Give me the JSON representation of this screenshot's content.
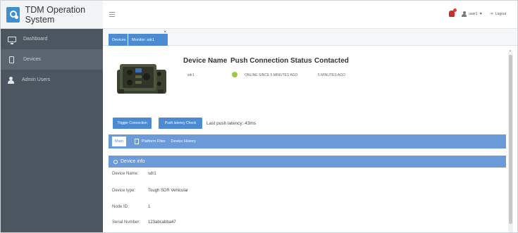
{
  "app": {
    "title": "TDM Operation System"
  },
  "sidebar": {
    "items": [
      {
        "label": "Dashboard",
        "icon": "monitor-icon"
      },
      {
        "label": "Devices",
        "icon": "device-icon"
      },
      {
        "label": "Admin Users",
        "icon": "user-icon"
      }
    ]
  },
  "topbar": {
    "user": "user1",
    "logout": "Logout"
  },
  "tabs": [
    {
      "label": "Devices"
    },
    {
      "label": "Monitor: sdr1"
    }
  ],
  "device": {
    "headers": {
      "name": "Device Name",
      "status": "Push Connection Status",
      "contacted": "Contacted"
    },
    "name": "sdr1",
    "status": "ONLINE SINCE 5 MINUTES AGO",
    "contacted": "5 MINUTES AGO",
    "status_color": "#9ccc3d"
  },
  "actions": {
    "trigger": "Trigger Connection",
    "latency_check": "Push latency Check",
    "last_latency": "Last push latency: 43ms"
  },
  "subtabs": {
    "main": "Main",
    "platform_files": "Platform Files",
    "device_history": "Device History"
  },
  "info": {
    "title": "Device info",
    "rows": [
      {
        "label": "Device Name:",
        "value": "sdr1"
      },
      {
        "label": "Device type:",
        "value": "Tough SDR Vehicular"
      },
      {
        "label": "Node ID:",
        "value": "1"
      },
      {
        "label": "Serial Number:",
        "value": "123abcabba47"
      }
    ]
  },
  "colors": {
    "accent": "#4c8bd1",
    "sidebar": "#4b5661",
    "panel": "#6b9ad8"
  }
}
